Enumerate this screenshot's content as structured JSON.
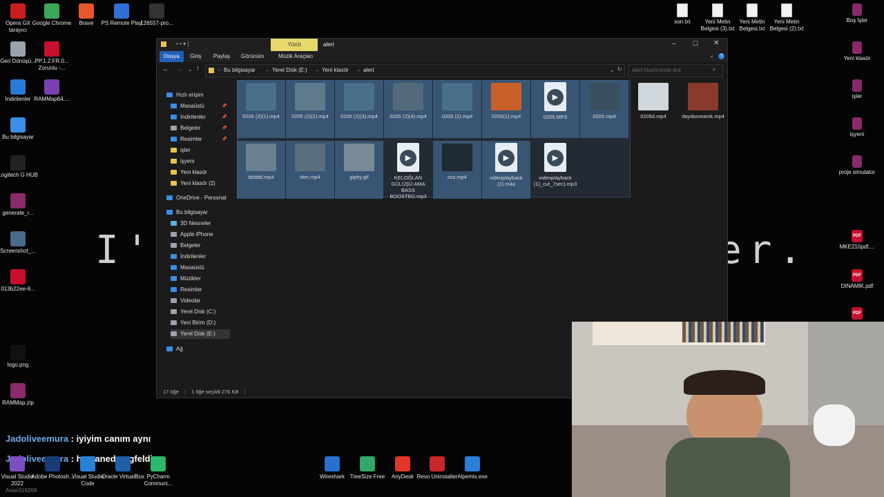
{
  "desktop_left_icons": [
    {
      "label": "Opera GX tarayıcı",
      "icon": "opera-icon",
      "color": "#c81e1e"
    },
    {
      "label": "Google Chrome",
      "icon": "chrome-icon",
      "color": "#3aa657"
    },
    {
      "label": "Brave",
      "icon": "brave-icon",
      "color": "#e8562a"
    },
    {
      "label": "PS Remote Play",
      "icon": "ps-remote-icon",
      "color": "#2f6fd6"
    },
    {
      "label": "126557-pro...",
      "icon": "file-icon",
      "color": "#333333"
    },
    {
      "label": "Geri Dönüşü...",
      "icon": "recycle-bin-icon",
      "color": "#9aa3ad"
    },
    {
      "label": "PP.1.2.FR.0... Zorunlu -...",
      "icon": "pdf-icon",
      "color": "#c8102e"
    },
    {
      "label": "İndirilenler",
      "icon": "downloads-icon",
      "color": "#2a7bd8"
    },
    {
      "label": "RAMMap64....",
      "icon": "rammap-icon",
      "color": "#7a3fb0"
    },
    {
      "label": "Bu bilgisayar",
      "icon": "computer-icon",
      "color": "#3a8ee6"
    },
    {
      "label": "Logitech G HUB",
      "icon": "logitech-icon",
      "color": "#222222"
    },
    {
      "label": "generate_r...",
      "icon": "winrar-icon",
      "color": "#8a2a6a"
    },
    {
      "label": "Screenshot_...",
      "icon": "image-icon",
      "color": "#4a6a8a"
    },
    {
      "label": "013b22ee-6...",
      "icon": "pdf-icon",
      "color": "#c8102e"
    },
    {
      "label": "logo.png",
      "icon": "image-icon",
      "color": "#111111"
    },
    {
      "label": "RAMMap.zip",
      "icon": "winrar-icon",
      "color": "#8a2a6a"
    }
  ],
  "desktop_right_icons": [
    {
      "label": "son.txt",
      "icon": "text-file-icon"
    },
    {
      "label": "Yeni Metin Belgesi (3).txt",
      "icon": "text-file-icon"
    },
    {
      "label": "Yeni Metin Belgesi.txt",
      "icon": "text-file-icon"
    },
    {
      "label": "Yeni Metin Belgesi (2).txt",
      "icon": "text-file-icon"
    },
    {
      "label": "Boş İşler",
      "icon": "winrar-icon"
    },
    {
      "label": "Yeni klasör",
      "icon": "winrar-icon"
    },
    {
      "label": "işler",
      "icon": "winrar-icon"
    },
    {
      "label": "işyeni",
      "icon": "winrar-icon"
    },
    {
      "label": "proje simulator",
      "icon": "winrar-icon"
    },
    {
      "label": "MKE210pdf....",
      "icon": "pdf-icon"
    },
    {
      "label": "DINAMIK.pdf",
      "icon": "pdf-icon"
    }
  ],
  "overlay_text": {
    "left": "I'r",
    "right": "er."
  },
  "explorer": {
    "title": "alert",
    "tool_tab": "Yürüt",
    "ribbon_tabs": [
      "Dosya",
      "Giriş",
      "Paylaş",
      "Görünüm",
      "Müzik Araçları"
    ],
    "breadcrumb": [
      "Bu bilgisayar",
      "Yerel Disk (E:)",
      "Yeni klasör",
      "alert"
    ],
    "search_placeholder": "alert klasöründe ara",
    "nav_items": [
      {
        "label": "Hızlı erişim",
        "icon": "star-icon",
        "pinned": false
      },
      {
        "label": "Masaüstü",
        "icon": "desktop-icon",
        "pinned": true
      },
      {
        "label": "İndirilenler",
        "icon": "downloads-icon",
        "pinned": true
      },
      {
        "label": "Belgeler",
        "icon": "documents-icon",
        "pinned": true
      },
      {
        "label": "Resimler",
        "icon": "pictures-icon",
        "pinned": true
      },
      {
        "label": "işler",
        "icon": "folder-icon",
        "pinned": false
      },
      {
        "label": "işyeni",
        "icon": "folder-icon",
        "pinned": false
      },
      {
        "label": "Yeni klasör",
        "icon": "folder-icon",
        "pinned": false
      },
      {
        "label": "Yeni klasör (2)",
        "icon": "folder-icon",
        "pinned": false
      },
      {
        "label": "OneDrive - Personal",
        "icon": "onedrive-icon",
        "pinned": false
      },
      {
        "label": "Bu bilgisayar",
        "icon": "computer-icon",
        "pinned": false
      },
      {
        "label": "3D Nesneler",
        "icon": "3d-objects-icon",
        "pinned": false
      },
      {
        "label": "Apple iPhone",
        "icon": "phone-icon",
        "pinned": false
      },
      {
        "label": "Belgeler",
        "icon": "documents-icon",
        "pinned": false
      },
      {
        "label": "İndirilenler",
        "icon": "downloads-icon",
        "pinned": false
      },
      {
        "label": "Masaüstü",
        "icon": "desktop-icon",
        "pinned": false
      },
      {
        "label": "Müzikler",
        "icon": "music-icon",
        "pinned": false
      },
      {
        "label": "Resimler",
        "icon": "pictures-icon",
        "pinned": false
      },
      {
        "label": "Videolar",
        "icon": "videos-icon",
        "pinned": false
      },
      {
        "label": "Yerel Disk (C:)",
        "icon": "drive-icon",
        "pinned": false
      },
      {
        "label": "Yeni Birim (D:)",
        "icon": "drive-icon",
        "pinned": false
      },
      {
        "label": "Yerel Disk (E:)",
        "icon": "drive-icon",
        "pinned": false,
        "active": true
      },
      {
        "label": "Ağ",
        "icon": "network-icon",
        "pinned": false
      }
    ],
    "files": [
      {
        "name": "0205 (2)(1).mp4",
        "kind": "video",
        "color": "#4a6f8a",
        "selected": true
      },
      {
        "name": "0205 (2)(2).mp4",
        "kind": "video",
        "color": "#5f7a8c",
        "selected": true
      },
      {
        "name": "0205 (2)(3).mp4",
        "kind": "video",
        "color": "#4a6f8a",
        "selected": true
      },
      {
        "name": "0205 (2)(4).mp4",
        "kind": "video",
        "color": "#536a7a",
        "selected": true
      },
      {
        "name": "0205 (2).mp4",
        "kind": "video",
        "color": "#4a6f8a",
        "selected": true
      },
      {
        "name": "0205(1).mp4",
        "kind": "video",
        "color": "#c8602a",
        "selected": true
      },
      {
        "name": "0205.MP3",
        "kind": "audio",
        "color": "#e8edf3",
        "selected": true
      },
      {
        "name": "0205.mp4",
        "kind": "video",
        "color": "#3a5060",
        "selected": true
      },
      {
        "name": "0205d.mp4",
        "kind": "video",
        "color": "#cfd6dc",
        "selected": false
      },
      {
        "name": "dayıbuneamk.mp4",
        "kind": "video",
        "color": "#8a3a2a",
        "selected": false
      },
      {
        "name": "ddddd.mp4",
        "kind": "video",
        "color": "#6a7f90",
        "selected": true
      },
      {
        "name": "don.mp4",
        "kind": "video",
        "color": "#5a6e7e",
        "selected": true
      },
      {
        "name": "giphy.gif",
        "kind": "video",
        "color": "#7a8a96",
        "selected": true
      },
      {
        "name": "KELOĞLAN GÜLÜŞÜ AMA BASS BOOSTED.mp3",
        "kind": "audio",
        "color": "#e8edf3",
        "selected": false
      },
      {
        "name": "sss.mp4",
        "kind": "video",
        "color": "#1f2a33",
        "selected": true
      },
      {
        "name": "videoplayback (1).m4a",
        "kind": "audio",
        "color": "#e8edf3",
        "selected": true
      },
      {
        "name": "videoplayback (1)_cut_7sec).mp3",
        "kind": "audio",
        "color": "#e8edf3",
        "selected": false
      }
    ],
    "status": {
      "count": "17 öğe",
      "selection": "1 öğe seçildi 276 KB"
    }
  },
  "chat": [
    {
      "user": "Jadoliveemura",
      "message": ": iyiyim canım aynı"
    },
    {
      "user": "Jadoliveemura",
      "message": ": hastaneden gfeldim"
    }
  ],
  "taskbar_icons": [
    {
      "label": "Visual Studio 2022",
      "color": "#7a4fc2"
    },
    {
      "label": "Adobe Photosh...",
      "color": "#1a3b7a"
    },
    {
      "label": "Visual Studio Code",
      "color": "#2a82d8"
    },
    {
      "label": "Oracle VirtualBox",
      "color": "#1f5fa8"
    },
    {
      "label": "PyCharm Communi...",
      "color": "#2ab86a"
    },
    {
      "label": "Wireshark",
      "color": "#2a6fd0"
    },
    {
      "label": "TreeSize Free",
      "color": "#2fa86a"
    },
    {
      "label": "AnyDesk",
      "color": "#e2362b"
    },
    {
      "label": "Revo Uninstaller",
      "color": "#c8262a"
    },
    {
      "label": "Alpemix.exe",
      "color": "#2a7fd8"
    }
  ],
  "watermark": "Anan316269"
}
